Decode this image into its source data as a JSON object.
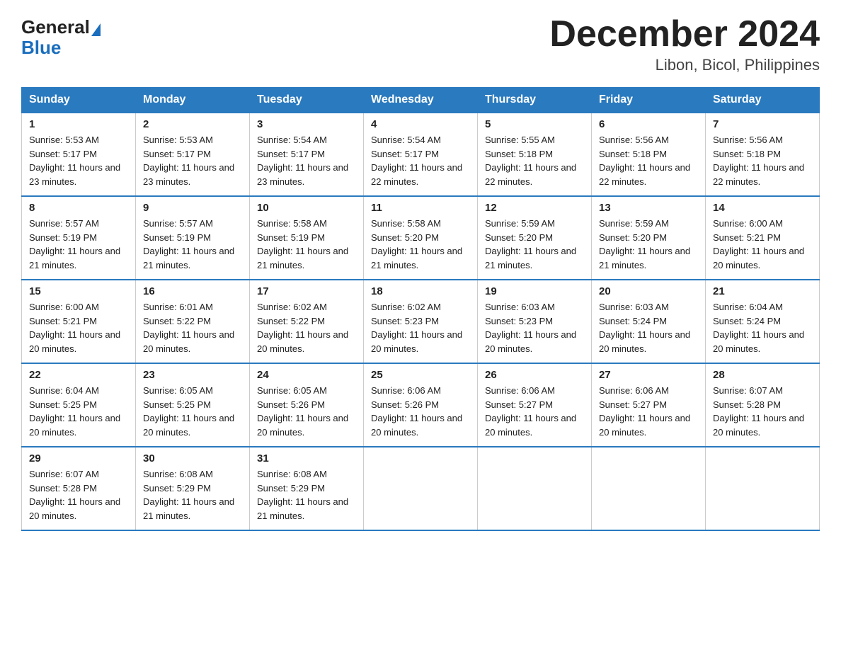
{
  "header": {
    "logo_general": "General",
    "logo_blue": "Blue",
    "title": "December 2024",
    "subtitle": "Libon, Bicol, Philippines"
  },
  "weekdays": [
    "Sunday",
    "Monday",
    "Tuesday",
    "Wednesday",
    "Thursday",
    "Friday",
    "Saturday"
  ],
  "weeks": [
    [
      {
        "day": "1",
        "sunrise": "5:53 AM",
        "sunset": "5:17 PM",
        "daylight": "11 hours and 23 minutes."
      },
      {
        "day": "2",
        "sunrise": "5:53 AM",
        "sunset": "5:17 PM",
        "daylight": "11 hours and 23 minutes."
      },
      {
        "day": "3",
        "sunrise": "5:54 AM",
        "sunset": "5:17 PM",
        "daylight": "11 hours and 23 minutes."
      },
      {
        "day": "4",
        "sunrise": "5:54 AM",
        "sunset": "5:17 PM",
        "daylight": "11 hours and 22 minutes."
      },
      {
        "day": "5",
        "sunrise": "5:55 AM",
        "sunset": "5:18 PM",
        "daylight": "11 hours and 22 minutes."
      },
      {
        "day": "6",
        "sunrise": "5:56 AM",
        "sunset": "5:18 PM",
        "daylight": "11 hours and 22 minutes."
      },
      {
        "day": "7",
        "sunrise": "5:56 AM",
        "sunset": "5:18 PM",
        "daylight": "11 hours and 22 minutes."
      }
    ],
    [
      {
        "day": "8",
        "sunrise": "5:57 AM",
        "sunset": "5:19 PM",
        "daylight": "11 hours and 21 minutes."
      },
      {
        "day": "9",
        "sunrise": "5:57 AM",
        "sunset": "5:19 PM",
        "daylight": "11 hours and 21 minutes."
      },
      {
        "day": "10",
        "sunrise": "5:58 AM",
        "sunset": "5:19 PM",
        "daylight": "11 hours and 21 minutes."
      },
      {
        "day": "11",
        "sunrise": "5:58 AM",
        "sunset": "5:20 PM",
        "daylight": "11 hours and 21 minutes."
      },
      {
        "day": "12",
        "sunrise": "5:59 AM",
        "sunset": "5:20 PM",
        "daylight": "11 hours and 21 minutes."
      },
      {
        "day": "13",
        "sunrise": "5:59 AM",
        "sunset": "5:20 PM",
        "daylight": "11 hours and 21 minutes."
      },
      {
        "day": "14",
        "sunrise": "6:00 AM",
        "sunset": "5:21 PM",
        "daylight": "11 hours and 20 minutes."
      }
    ],
    [
      {
        "day": "15",
        "sunrise": "6:00 AM",
        "sunset": "5:21 PM",
        "daylight": "11 hours and 20 minutes."
      },
      {
        "day": "16",
        "sunrise": "6:01 AM",
        "sunset": "5:22 PM",
        "daylight": "11 hours and 20 minutes."
      },
      {
        "day": "17",
        "sunrise": "6:02 AM",
        "sunset": "5:22 PM",
        "daylight": "11 hours and 20 minutes."
      },
      {
        "day": "18",
        "sunrise": "6:02 AM",
        "sunset": "5:23 PM",
        "daylight": "11 hours and 20 minutes."
      },
      {
        "day": "19",
        "sunrise": "6:03 AM",
        "sunset": "5:23 PM",
        "daylight": "11 hours and 20 minutes."
      },
      {
        "day": "20",
        "sunrise": "6:03 AM",
        "sunset": "5:24 PM",
        "daylight": "11 hours and 20 minutes."
      },
      {
        "day": "21",
        "sunrise": "6:04 AM",
        "sunset": "5:24 PM",
        "daylight": "11 hours and 20 minutes."
      }
    ],
    [
      {
        "day": "22",
        "sunrise": "6:04 AM",
        "sunset": "5:25 PM",
        "daylight": "11 hours and 20 minutes."
      },
      {
        "day": "23",
        "sunrise": "6:05 AM",
        "sunset": "5:25 PM",
        "daylight": "11 hours and 20 minutes."
      },
      {
        "day": "24",
        "sunrise": "6:05 AM",
        "sunset": "5:26 PM",
        "daylight": "11 hours and 20 minutes."
      },
      {
        "day": "25",
        "sunrise": "6:06 AM",
        "sunset": "5:26 PM",
        "daylight": "11 hours and 20 minutes."
      },
      {
        "day": "26",
        "sunrise": "6:06 AM",
        "sunset": "5:27 PM",
        "daylight": "11 hours and 20 minutes."
      },
      {
        "day": "27",
        "sunrise": "6:06 AM",
        "sunset": "5:27 PM",
        "daylight": "11 hours and 20 minutes."
      },
      {
        "day": "28",
        "sunrise": "6:07 AM",
        "sunset": "5:28 PM",
        "daylight": "11 hours and 20 minutes."
      }
    ],
    [
      {
        "day": "29",
        "sunrise": "6:07 AM",
        "sunset": "5:28 PM",
        "daylight": "11 hours and 20 minutes."
      },
      {
        "day": "30",
        "sunrise": "6:08 AM",
        "sunset": "5:29 PM",
        "daylight": "11 hours and 21 minutes."
      },
      {
        "day": "31",
        "sunrise": "6:08 AM",
        "sunset": "5:29 PM",
        "daylight": "11 hours and 21 minutes."
      },
      null,
      null,
      null,
      null
    ]
  ],
  "labels": {
    "sunrise": "Sunrise:",
    "sunset": "Sunset:",
    "daylight": "Daylight:"
  }
}
